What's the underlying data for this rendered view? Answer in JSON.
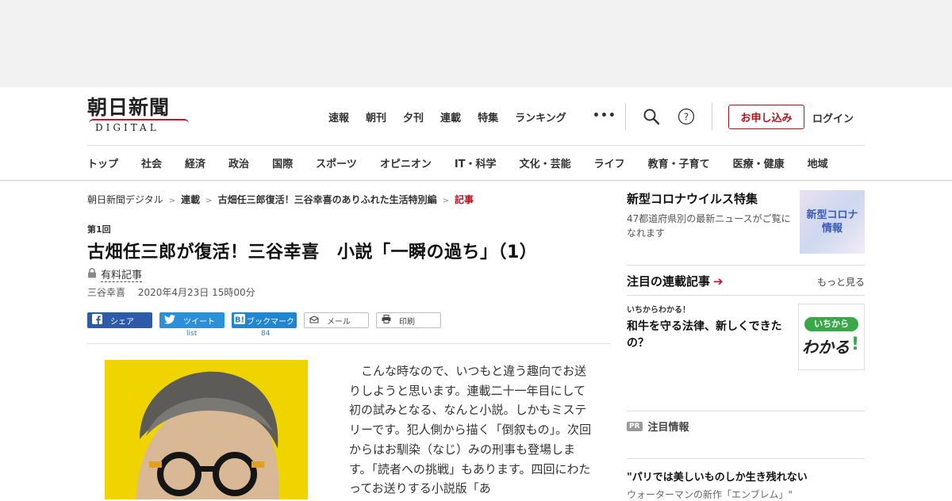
{
  "header": {
    "logo_jp": "朝日新聞",
    "logo_en": "DIGITAL",
    "top_nav": [
      "速報",
      "朝刊",
      "夕刊",
      "連載",
      "特集",
      "ランキング"
    ],
    "more": "•••",
    "apply_label": "お申し込み",
    "login_label": "ログイン",
    "categories": [
      "トップ",
      "社会",
      "経済",
      "政治",
      "国際",
      "スポーツ",
      "オピニオン",
      "IT・科学",
      "文化・芸能",
      "ライフ",
      "教育・子育て",
      "医療・健康",
      "地域"
    ]
  },
  "breadcrumb": {
    "items": [
      "朝日新聞デジタル",
      "連載",
      "古畑任三郎復活！三谷幸喜のありふれた生活特別編"
    ],
    "current": "記事",
    "separator": ">"
  },
  "article": {
    "kicker": "第1回",
    "title": "古畑任三郎が復活！三谷幸喜　小説「一瞬の過ち」（1）",
    "paid_label": "有料記事",
    "author": "三谷幸喜",
    "date": "2020年4月23日 15時00分",
    "share": {
      "facebook": "シェア",
      "twitter": "ツイート",
      "hatena": "ブックマーク",
      "mail": "メール",
      "print": "印刷",
      "twitter_count": "list",
      "hatena_count": "84"
    },
    "body": "　こんな時なので、いつもと違う趣向でお送りしようと思います。連載二十一年目にして初の試みとなる、なんと小説。しかもミステリーです。犯人側から描く「倒叙もの」。次回からはお馴染（なじ）みの刑事も登場します。「読者への挑戦」もあります。四回にわたってお送りする小説版「あ"
  },
  "sidebar": {
    "corona": {
      "title": "新型コロナウイルス特集",
      "desc": "47都道府県別の最新ニュースがご覧になれます",
      "thumb_text": "新型コロナ\n情報"
    },
    "serial": {
      "heading": "注目の連載記事",
      "more": "もっと見る",
      "kicker": "いちからわかる！",
      "headline": "和牛を守る法律、新しくできたの？",
      "badge_top": "いちから",
      "badge_main": "わかる"
    },
    "pr": {
      "badge": "PR",
      "label": "注目情報",
      "headline": "\"パリでは美しいものしか生き残れない",
      "sub": "ウォーターマンの新作「エンブレム」\""
    }
  },
  "colors": {
    "brand_red": "#b5121b",
    "facebook": "#2d5ba8",
    "twitter": "#2a90d8",
    "hatena": "#1f86cf",
    "photo_bg": "#f0d400"
  }
}
